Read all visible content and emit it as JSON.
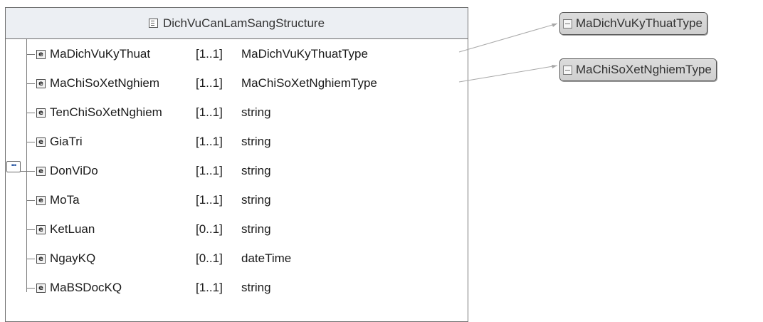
{
  "structure": {
    "title": "DichVuCanLamSangStructure",
    "sequence_icon": "•••",
    "elements": [
      {
        "name": "MaDichVuKyThuat",
        "cardinality": "[1..1]",
        "type": "MaDichVuKyThuatType"
      },
      {
        "name": "MaChiSoXetNghiem",
        "cardinality": "[1..1]",
        "type": "MaChiSoXetNghiemType"
      },
      {
        "name": "TenChiSoXetNghiem",
        "cardinality": "[1..1]",
        "type": "string"
      },
      {
        "name": "GiaTri",
        "cardinality": "[1..1]",
        "type": "string"
      },
      {
        "name": "DonViDo",
        "cardinality": "[1..1]",
        "type": "string"
      },
      {
        "name": "MoTa",
        "cardinality": "[1..1]",
        "type": "string"
      },
      {
        "name": "KetLuan",
        "cardinality": "[0..1]",
        "type": "string"
      },
      {
        "name": "NgayKQ",
        "cardinality": "[0..1]",
        "type": "dateTime"
      },
      {
        "name": "MaBSDocKQ",
        "cardinality": "[1..1]",
        "type": "string"
      }
    ]
  },
  "type_boxes": [
    {
      "label": "MaDichVuKyThuatType"
    },
    {
      "label": "MaChiSoXetNghiemType"
    }
  ],
  "element_icon_letter": "e"
}
